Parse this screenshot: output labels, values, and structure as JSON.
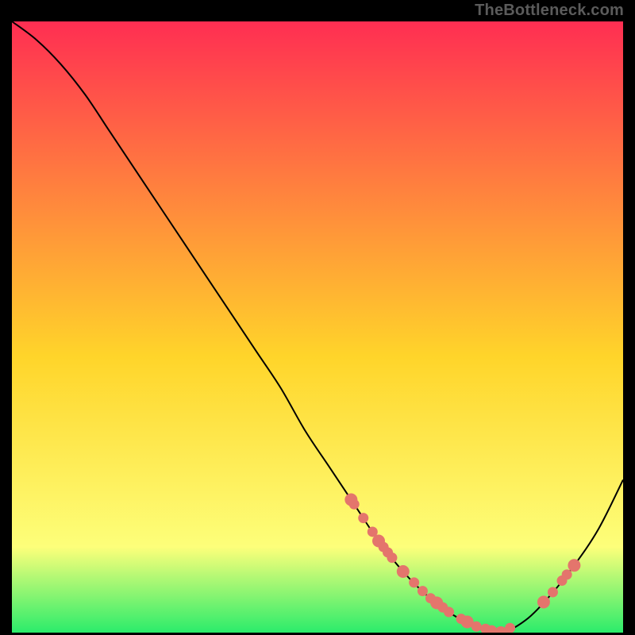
{
  "attribution": "TheBottleneck.com",
  "colors": {
    "gradient_top": "#FF2E52",
    "gradient_mid": "#FFD52A",
    "gradient_low": "#FDFF7A",
    "gradient_bottom": "#2BEC6B",
    "curve": "#000000",
    "marker": "#E4756C",
    "background": "#000000"
  },
  "chart_data": {
    "type": "line",
    "x": [
      0.0,
      0.04,
      0.08,
      0.12,
      0.16,
      0.2,
      0.24,
      0.28,
      0.32,
      0.36,
      0.4,
      0.44,
      0.48,
      0.52,
      0.56,
      0.6,
      0.64,
      0.68,
      0.72,
      0.76,
      0.8,
      0.84,
      0.88,
      0.92,
      0.96,
      1.0
    ],
    "values": [
      1.0,
      0.97,
      0.93,
      0.88,
      0.82,
      0.76,
      0.7,
      0.64,
      0.58,
      0.52,
      0.46,
      0.4,
      0.33,
      0.27,
      0.21,
      0.15,
      0.1,
      0.06,
      0.03,
      0.01,
      0.0,
      0.02,
      0.06,
      0.11,
      0.17,
      0.25
    ],
    "xlim": [
      0,
      1
    ],
    "ylim": [
      0,
      1
    ],
    "marker_cluster": {
      "left_arm_x": [
        0.555,
        0.56,
        0.575,
        0.59,
        0.6,
        0.608,
        0.615,
        0.622,
        0.64,
        0.658,
        0.672,
        0.685,
        0.695,
        0.705,
        0.715,
        0.735,
        0.745,
        0.76,
        0.775,
        0.785,
        0.8,
        0.815
      ],
      "right_arm_x": [
        0.87,
        0.885,
        0.9,
        0.908,
        0.92
      ]
    }
  }
}
